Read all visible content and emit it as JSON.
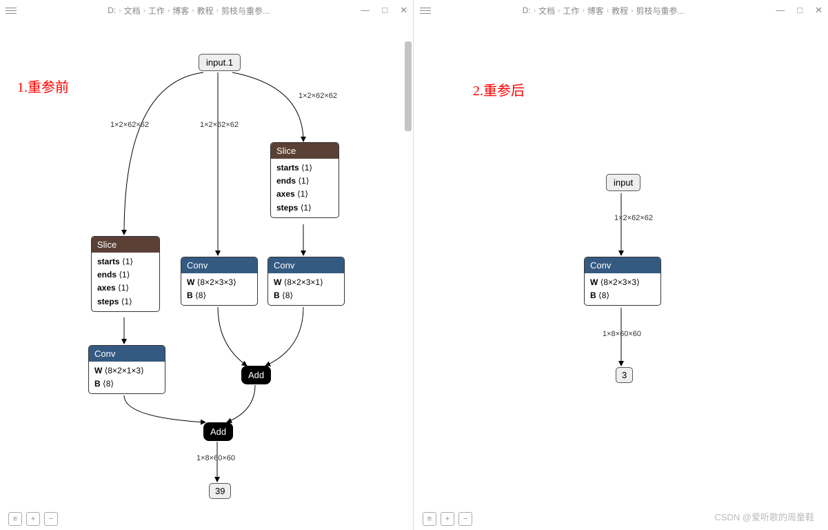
{
  "breadcrumb": {
    "drive": "D:",
    "p1": "文档",
    "p2": "工作",
    "p3": "博客",
    "p4": "教程",
    "p5": "剪枝与重参..."
  },
  "annotations": {
    "before": "1.重参前",
    "after": "2.重参后"
  },
  "left": {
    "input": "input.1",
    "e_input_slice": "1×2×62×62",
    "e_input_conv": "1×2×62×62",
    "e_input_slice2": "1×2×62×62",
    "slice1": {
      "title": "Slice",
      "starts": "starts",
      "ends": "ends",
      "axes": "axes",
      "steps": "steps",
      "v": "⟨1⟩"
    },
    "slice2": {
      "title": "Slice",
      "starts": "starts",
      "ends": "ends",
      "axes": "axes",
      "steps": "steps",
      "v": "⟨1⟩"
    },
    "conv_mid": {
      "title": "Conv",
      "W": "W",
      "Wv": "⟨8×2×3×3⟩",
      "B": "B",
      "Bv": "⟨8⟩"
    },
    "conv_right": {
      "title": "Conv",
      "W": "W",
      "Wv": "⟨8×2×3×1⟩",
      "B": "B",
      "Bv": "⟨8⟩"
    },
    "conv_left": {
      "title": "Conv",
      "W": "W",
      "Wv": "⟨8×2×1×3⟩",
      "B": "B",
      "Bv": "⟨8⟩"
    },
    "add1": "Add",
    "add2": "Add",
    "out_label": "1×8×60×60",
    "out": "39"
  },
  "right": {
    "input": "input",
    "e_input_conv": "1×2×62×62",
    "conv": {
      "title": "Conv",
      "W": "W",
      "Wv": "⟨8×2×3×3⟩",
      "B": "B",
      "Bv": "⟨8⟩"
    },
    "out_label": "1×8×60×60",
    "out": "3"
  },
  "watermark": "CSDN @爱听歌的周童鞋"
}
